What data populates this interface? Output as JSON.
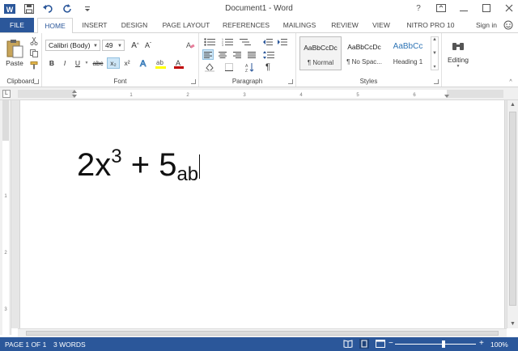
{
  "titlebar": {
    "title": "Document1 - Word",
    "help": "?"
  },
  "tabs": {
    "file": "FILE",
    "home": "HOME",
    "insert": "INSERT",
    "design": "DESIGN",
    "page_layout": "PAGE LAYOUT",
    "references": "REFERENCES",
    "mailings": "MAILINGS",
    "review": "REVIEW",
    "view": "VIEW",
    "nitro": "NITRO PRO 10",
    "signin": "Sign in"
  },
  "clipboard": {
    "label": "Clipboard",
    "paste": "Paste"
  },
  "font": {
    "label": "Font",
    "family": "Calibri (Body)",
    "size": "49",
    "bold": "B",
    "italic": "I",
    "underline": "U",
    "strike": "abc",
    "subscript": "x₂",
    "superscript": "x²",
    "grow": "A^",
    "shrink": "A˅",
    "color_red": "#c00000",
    "highlight_yellow": "#ffff00"
  },
  "paragraph": {
    "label": "Paragraph",
    "pilcrow": "¶"
  },
  "styles": {
    "label": "Styles",
    "items": [
      {
        "sample": "AaBbCcDc",
        "name": "¶ Normal"
      },
      {
        "sample": "AaBbCcDc",
        "name": "¶ No Spac..."
      },
      {
        "sample": "AaBbCc",
        "name": "Heading 1"
      }
    ]
  },
  "editing": {
    "label": "Editing"
  },
  "document": {
    "base1": "2x",
    "exp": "3",
    "plus": " + 5",
    "sub": "ab"
  },
  "status": {
    "page": "PAGE 1 OF 1",
    "words": "3 WORDS",
    "zoom": "100%",
    "minus": "−",
    "plus": "+"
  },
  "colors": {
    "brand": "#2b579a",
    "heading_blue": "#2e74b5"
  }
}
